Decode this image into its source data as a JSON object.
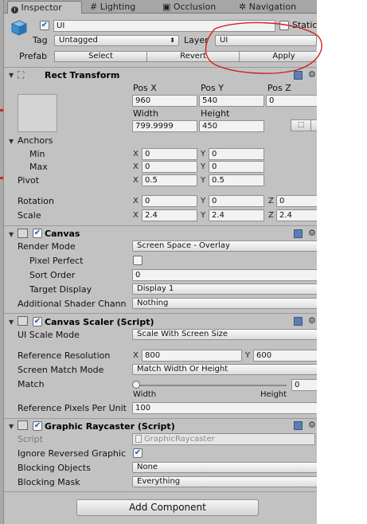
{
  "tabs": [
    {
      "label": "Inspector",
      "icon": "info-icon"
    },
    {
      "label": "Lighting",
      "icon": "lighting-icon"
    },
    {
      "label": "Occlusion",
      "icon": "occlusion-icon"
    },
    {
      "label": "Navigation",
      "icon": "navigation-icon"
    }
  ],
  "object": {
    "name": "UI",
    "static_label": "Static",
    "tag_label": "Tag",
    "tag_value": "Untagged",
    "layer_label": "Layer",
    "layer_value": "UI",
    "prefab_label": "Prefab",
    "prefab_buttons": [
      "Select",
      "Revert",
      "Apply"
    ]
  },
  "rect_transform": {
    "title": "Rect Transform",
    "col_labels": [
      "Pos X",
      "Pos Y",
      "Pos Z"
    ],
    "pos": [
      "960",
      "540",
      "0"
    ],
    "size_labels": [
      "Width",
      "Height"
    ],
    "size": [
      "799.9999",
      "450"
    ],
    "anchors_label": "Anchors",
    "min_label": "Min",
    "min": [
      "0",
      "0"
    ],
    "max_label": "Max",
    "max": [
      "0",
      "0"
    ],
    "pivot_label": "Pivot",
    "pivot": [
      "0.5",
      "0.5"
    ],
    "rotation_label": "Rotation",
    "rotation": [
      "0",
      "0",
      "0"
    ],
    "scale_label": "Scale",
    "scale": [
      "2.4",
      "2.4",
      "2.4"
    ],
    "axis": [
      "X",
      "Y",
      "Z"
    ]
  },
  "canvas": {
    "title": "Canvas",
    "render_mode_label": "Render Mode",
    "render_mode": "Screen Space - Overlay",
    "pixel_perfect_label": "Pixel Perfect",
    "sort_order_label": "Sort Order",
    "sort_order": "0",
    "target_display_label": "Target Display",
    "target_display": "Display 1",
    "shader_channels_label": "Additional Shader Chann",
    "shader_channels": "Nothing"
  },
  "canvas_scaler": {
    "title": "Canvas Scaler (Script)",
    "ui_scale_mode_label": "UI Scale Mode",
    "ui_scale_mode": "Scale With Screen Size",
    "ref_res_label": "Reference Resolution",
    "ref_res": [
      "800",
      "600"
    ],
    "screen_match_label": "Screen Match Mode",
    "screen_match": "Match Width Or Height",
    "match_label": "Match",
    "match_value": "0",
    "match_fraction": 0,
    "slider_left": "Width",
    "slider_right": "Height",
    "ref_pixels_label": "Reference Pixels Per Unit",
    "ref_pixels": "100"
  },
  "graphic_raycaster": {
    "title": "Graphic Raycaster (Script)",
    "script_label": "Script",
    "script": "GraphicRaycaster",
    "ignore_reversed_label": "Ignore Reversed Graphic",
    "blocking_objects_label": "Blocking Objects",
    "blocking_objects": "None",
    "blocking_mask_label": "Blocking Mask",
    "blocking_mask": "Everything"
  },
  "add_component_label": "Add Component",
  "colors": {
    "panel": "#c2c2c2",
    "annotation": "#d22222",
    "checkbox": "#1d5fb4"
  }
}
